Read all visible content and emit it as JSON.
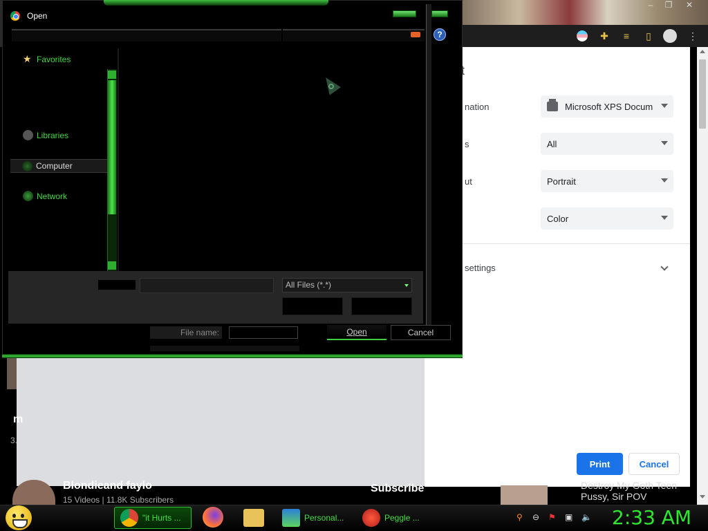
{
  "dialog": {
    "title": "Open",
    "help_label": "?",
    "nav": {
      "favorites": "Favorites",
      "libraries": "Libraries",
      "computer": "Computer",
      "network": "Network"
    },
    "file_type_filter": "All Files (*.*)",
    "file_name_label": "File name:",
    "open_label": "Open",
    "cancel_label": "Cancel"
  },
  "print_panel": {
    "destination_label": "nation",
    "destination_value": "Microsoft XPS Docum",
    "pages_label": "s",
    "pages_value": "All",
    "layout_label": "ut",
    "layout_value": "Portrait",
    "color_value": "Color",
    "more_settings_label": "settings",
    "header_fragment": "t",
    "print_button": "Print",
    "cancel_button": "Cancel"
  },
  "background_page": {
    "channel_name": "Blondieand faylo",
    "channel_stats": "15 Videos | 11.8K Subscribers",
    "subscribe_label": "Subscribe",
    "video_title_line1": "Destroy My Goth Teen",
    "video_title_line2": "Pussy, Sir POV",
    "fragment_m": "m",
    "fragment_3": "3."
  },
  "taskbar": {
    "items": [
      {
        "label": "\"it Hurts ...",
        "icon": "chrome-icon"
      },
      {
        "label": "Personal...",
        "icon": "monitor-icon"
      },
      {
        "label": "Peggle ...",
        "icon": "peggle-icon"
      }
    ],
    "clock": "2:33 AM"
  },
  "colors": {
    "accent_green": "#41d841",
    "print_blue": "#1a73e8"
  }
}
